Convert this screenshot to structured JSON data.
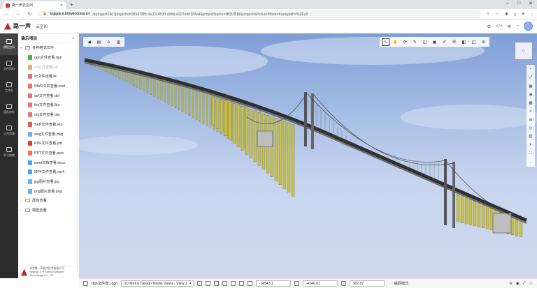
{
  "browser": {
    "tab_title": "路一声云空间",
    "url_host": "ksjspace.bimwindows.cn",
    "url_path": "/#/projectFile?projectId=9894788c-6e13-4530-a9bb-d227e8d184a4&projectName=演示项目&projectIsPictureMode=true&path=%2Fall"
  },
  "header": {
    "brand": "路一声",
    "subtitle": "云空间"
  },
  "leftnav": {
    "items": [
      {
        "label": "模型空间",
        "icon": "cube-icon",
        "active": true
      },
      {
        "label": "文件资料",
        "icon": "file-icon",
        "active": false
      },
      {
        "label": "工作台",
        "icon": "briefcase-icon",
        "active": false
      },
      {
        "label": "团队协作",
        "icon": "team-icon",
        "active": false
      },
      {
        "label": "公共资源",
        "icon": "database-icon",
        "active": false
      },
      {
        "label": "学习指南",
        "icon": "book-icon",
        "active": false
      }
    ]
  },
  "tree": {
    "title": "演示项目",
    "plus": "+",
    "root_folder": "多种格式文件",
    "files": [
      {
        "label": "dgn文件查看.dgn",
        "color": "#4caf50"
      },
      {
        "label": "rvt文件查看.rvt",
        "color": "#f0a860",
        "dim": true
      },
      {
        "label": "ifc文件查看.ifc",
        "color": "#e57373"
      },
      {
        "label": "NWD文件查看.nwd",
        "color": "#ef6c6c"
      },
      {
        "label": "dxf文件查看.dxf",
        "color": "#e57373"
      },
      {
        "label": "fbx文件查看.fbx",
        "color": "#e57373"
      },
      {
        "label": "obj文件查看.obj",
        "color": "#e57373"
      },
      {
        "label": "SKP文件查看.skp",
        "color": "#ef5350"
      },
      {
        "label": "dwg文件查看.dwg",
        "color": "#64b5f6"
      },
      {
        "label": "PDF文件查看.pdf",
        "color": "#e53935"
      },
      {
        "label": "PPT文件查看.pptx",
        "color": "#ff7043"
      },
      {
        "label": "word文档查看.docx",
        "color": "#42a5f5"
      },
      {
        "label": "MP4文件查看.mp4",
        "color": "#42a5f5"
      },
      {
        "label": "jpg图片查看.jpg",
        "color": "#64b5f6"
      },
      {
        "label": "png图片查看.png",
        "color": "#64b5f6"
      }
    ],
    "other_folders": [
      "属性查看",
      "模型查看"
    ],
    "footer_line1": "北京路一声软件技术有限公司",
    "footer_line2": "Beijing Lu Yi Sheng Software Technology Co., Ltd."
  },
  "statusbar": {
    "file": "dgn文件查...dgn",
    "view_select": "3D Metric Design Model Views - View 1",
    "x": "-14543.1",
    "y": "-4746.81",
    "z": "382.87",
    "mode": "捕捉模式"
  },
  "colors": {
    "pier_yellow": "#c9c04a",
    "deck": "#3a3a3a",
    "sky_top": "#7f9ed6",
    "sky_bottom": "#cfd8ee"
  }
}
